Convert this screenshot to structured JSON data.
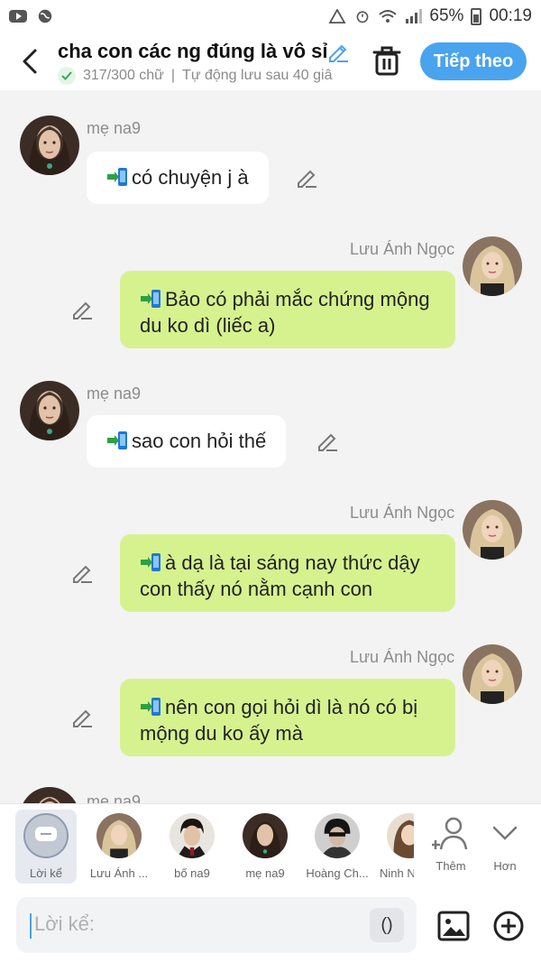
{
  "status": {
    "battery": "65%",
    "time": "00:19"
  },
  "header": {
    "title": "cha con các ng đúng là vô sỉ",
    "char_count": "317/300 chữ",
    "separator": "|",
    "autosave": "Tự động lưu sau 40 giâ",
    "next_label": "Tiếp theo"
  },
  "messages": [
    {
      "side": "left",
      "name": "mẹ na9",
      "text": "có chuyện j à"
    },
    {
      "side": "right",
      "name": "Lưu Ánh Ngọc",
      "text": "Bảo có phải mắc chứng mộng du ko dì (liếc a)"
    },
    {
      "side": "left",
      "name": "mẹ na9",
      "text": "sao con hỏi thế"
    },
    {
      "side": "right",
      "name": "Lưu Ánh Ngọc",
      "text": "à dạ là tại sáng nay thức dậy con thấy nó nằm cạnh con"
    },
    {
      "side": "right",
      "name": "Lưu Ánh Ngọc",
      "text": "nên con gọi hỏi dì là nó có bị mộng du ko ấy mà"
    },
    {
      "side": "left",
      "name": "mẹ na9",
      "text": ""
    }
  ],
  "tray": {
    "items": [
      {
        "label": "Lời kể"
      },
      {
        "label": "Lưu Ánh ..."
      },
      {
        "label": "bố na9"
      },
      {
        "label": "mẹ na9"
      },
      {
        "label": "Hoàng Ch..."
      },
      {
        "label": "Ninh N"
      }
    ],
    "more_label": "Thêm",
    "less_label": "Hơn"
  },
  "input": {
    "placeholder": "Lời kể:",
    "paren_label": "()"
  },
  "colors": {
    "accent": "#4aa3ef",
    "right_bubble": "#d6f28f",
    "left_bubble": "#ffffff"
  }
}
